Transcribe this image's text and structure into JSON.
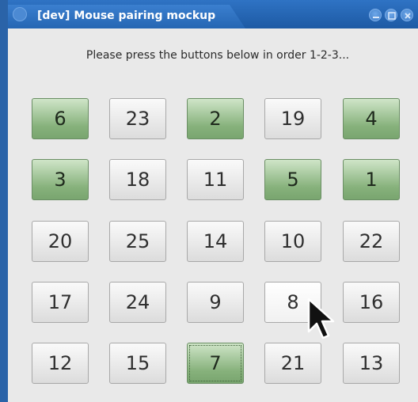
{
  "window": {
    "title": "[dev] Mouse pairing mockup"
  },
  "prompt": "Please press the buttons below in order 1-2-3...",
  "buttons": [
    {
      "label": "6",
      "state": "pressed"
    },
    {
      "label": "23",
      "state": "normal"
    },
    {
      "label": "2",
      "state": "pressed"
    },
    {
      "label": "19",
      "state": "normal"
    },
    {
      "label": "4",
      "state": "pressed"
    },
    {
      "label": "3",
      "state": "pressed"
    },
    {
      "label": "18",
      "state": "normal"
    },
    {
      "label": "11",
      "state": "normal"
    },
    {
      "label": "5",
      "state": "pressed"
    },
    {
      "label": "1",
      "state": "pressed"
    },
    {
      "label": "20",
      "state": "normal"
    },
    {
      "label": "25",
      "state": "normal"
    },
    {
      "label": "14",
      "state": "normal"
    },
    {
      "label": "10",
      "state": "normal"
    },
    {
      "label": "22",
      "state": "normal"
    },
    {
      "label": "17",
      "state": "normal"
    },
    {
      "label": "24",
      "state": "normal"
    },
    {
      "label": "9",
      "state": "normal"
    },
    {
      "label": "8",
      "state": "hover"
    },
    {
      "label": "16",
      "state": "normal"
    },
    {
      "label": "12",
      "state": "normal"
    },
    {
      "label": "15",
      "state": "normal"
    },
    {
      "label": "7",
      "state": "pressed-focused"
    },
    {
      "label": "21",
      "state": "normal"
    },
    {
      "label": "13",
      "state": "normal"
    }
  ],
  "icons": {
    "window_icon": "app-icon",
    "minimize": "minimize-icon",
    "maximize": "maximize-icon",
    "close": "close-icon",
    "pointer": "mouse-pointer-icon"
  },
  "colors": {
    "titlebar": "#2566b3",
    "pressed_button": "#86b17b",
    "normal_button": "#e6e6e6",
    "background": "#e9e9e9"
  }
}
